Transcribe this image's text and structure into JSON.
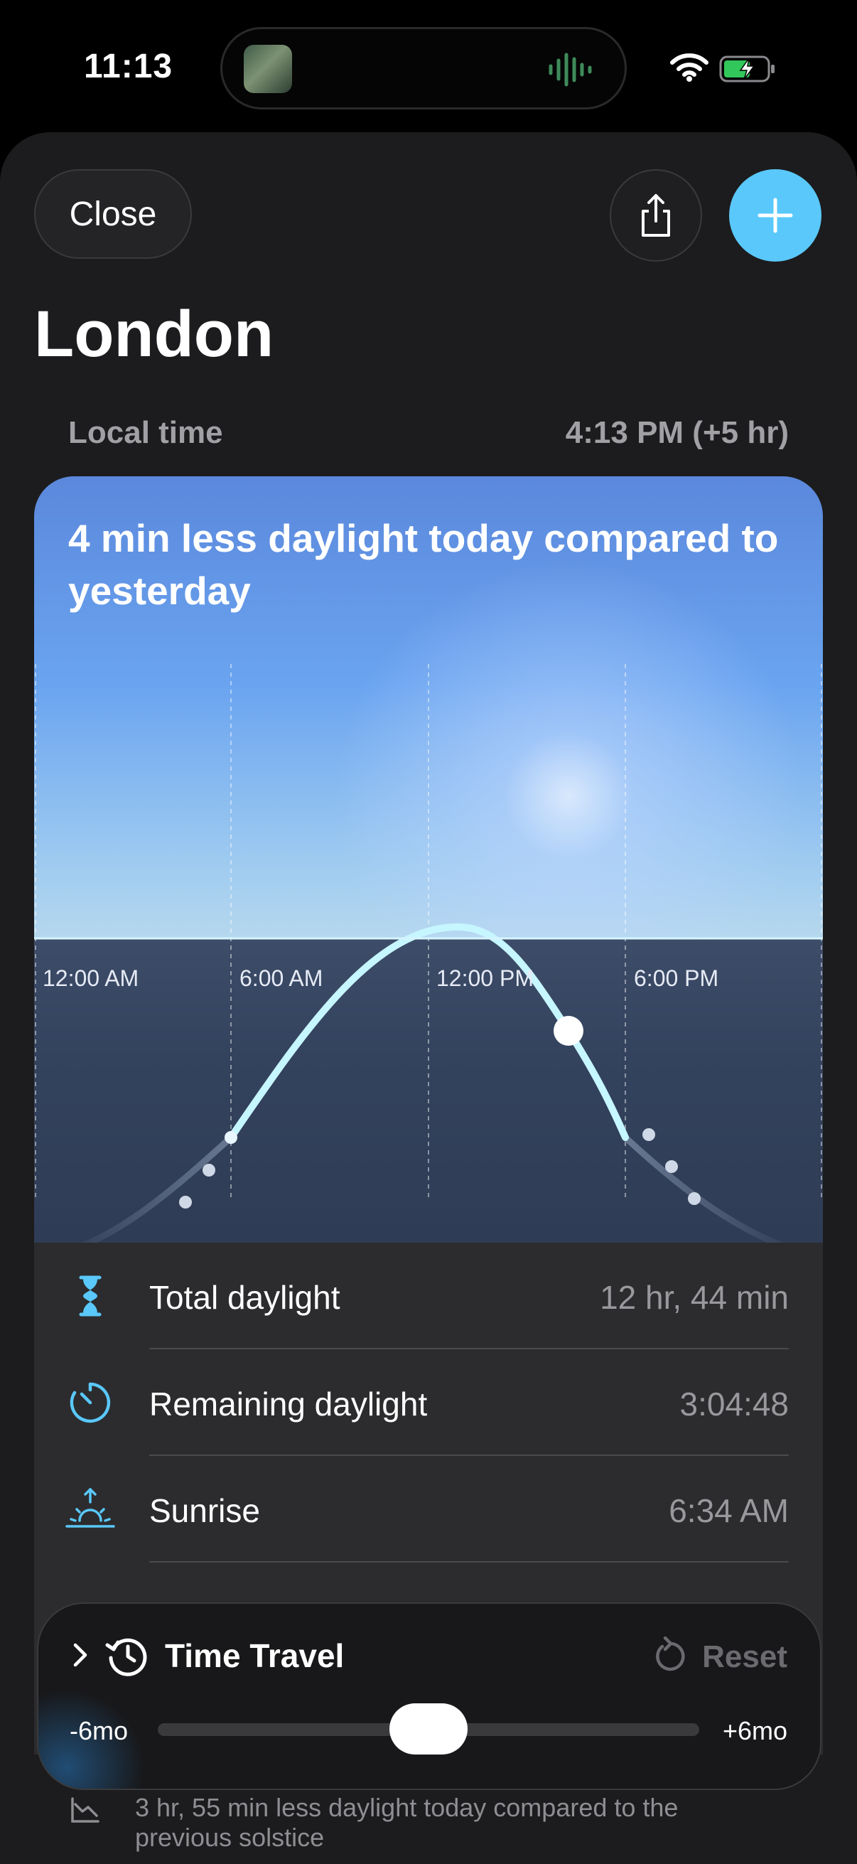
{
  "status_bar": {
    "time": "11:13"
  },
  "header": {
    "close_label": "Close",
    "title": "London"
  },
  "local_time": {
    "label": "Local time",
    "value": "4:13 PM (+5 hr)"
  },
  "daylight_card": {
    "headline": "4 min less daylight today compared to yesterday",
    "time_labels": [
      "12:00 AM",
      "6:00 AM",
      "12:00 PM",
      "6:00 PM"
    ]
  },
  "stats": [
    {
      "icon": "hourglass-icon",
      "label": "Total daylight",
      "value": "12 hr, 44 min"
    },
    {
      "icon": "timer-icon",
      "label": "Remaining daylight",
      "value": "3:04:48"
    },
    {
      "icon": "sunrise-icon",
      "label": "Sunrise",
      "value": "6:34 AM"
    }
  ],
  "time_travel": {
    "title": "Time Travel",
    "reset_label": "Reset",
    "min_label": "-6mo",
    "max_label": "+6mo",
    "slider_position": 0.5
  },
  "footer": {
    "note": "3 hr, 55 min less daylight today compared to the previous solstice"
  },
  "colors": {
    "accent": "#5ac8fa",
    "sky_top": "#5b88dc",
    "night": "#33425d",
    "sheet": "#1c1c1e"
  }
}
